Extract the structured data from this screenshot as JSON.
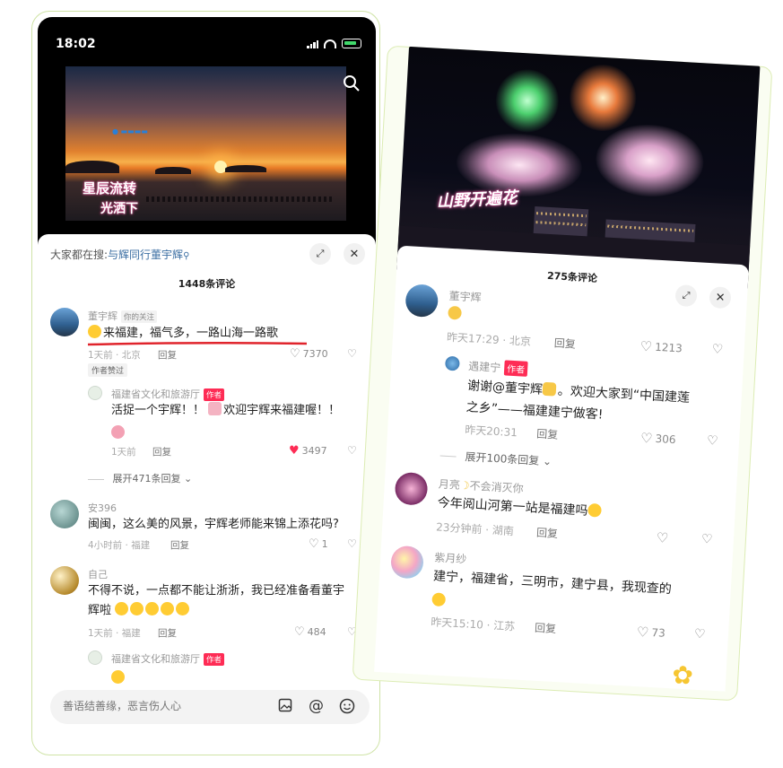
{
  "left": {
    "status_time": "18:02",
    "video_overlay_line1": "星辰流转",
    "video_overlay_line2": "光洒下",
    "trending_prefix": "大家都在搜:",
    "trending_query": "与辉同行董宇辉",
    "comment_count": "1448条评论",
    "comments": [
      {
        "name": "董宇辉",
        "badge": "你的关注",
        "text": "来福建，福气多，一路山海一路歌",
        "meta": "1天前 · 北京",
        "reply": "回复",
        "likes": "7370",
        "author_liked": "作者赞过",
        "sub": {
          "name": "福建省文化和旅游厅",
          "tag": "作者",
          "text1": "活捉一个宇辉！！",
          "text2": "欢迎宇辉来福建喔！！",
          "meta": "1天前",
          "reply": "回复",
          "likes": "3497"
        },
        "expand": "展开471条回复"
      },
      {
        "name": "安396",
        "text": "闽闽，这么美的风景，宇辉老师能来锦上添花吗?",
        "meta": "4小时前 · 福建",
        "reply": "回复",
        "likes": "1"
      },
      {
        "name": "自己",
        "text1": "不得不说，一点都不能让浙浙，我已经准备看董宇",
        "text2": "辉啦",
        "meta": "1天前 · 福建",
        "reply": "回复",
        "likes": "484",
        "sub": {
          "name": "福建省文化和旅游厅",
          "tag": "作者"
        }
      }
    ],
    "input_placeholder": "善语结善缘，恶言伤人心",
    "at_symbol": "@"
  },
  "right": {
    "video_overlay": "山野开遍花",
    "comment_count": "275条评论",
    "comments": [
      {
        "name": "董宇辉",
        "meta": "昨天17:29 · 北京",
        "reply": "回复",
        "likes": "1213",
        "sub": {
          "name": "遇建宁",
          "tag": "作者",
          "text1": "谢谢@董宇辉",
          "text1b": "。欢迎大家到“中国建莲",
          "text2": "之乡”——福建建宁做客!",
          "meta": "昨天20:31",
          "reply": "回复",
          "likes": "306"
        },
        "expand": "展开100条回复"
      },
      {
        "name": "月亮",
        "name2": "不会消灭你",
        "text": "今年阅山河第一站是福建吗",
        "meta": "23分钟前 · 湖南",
        "reply": "回复"
      },
      {
        "name": "紫月纱",
        "text": "建宁，福建省，三明市，建宁县，我现查的",
        "meta": "昨天15:10 · 江苏",
        "reply": "回复",
        "likes": "73"
      }
    ]
  },
  "colors": {
    "accent_red": "#fe2c55",
    "underline_red": "#e0242c",
    "frame_green": "#cfe3a6",
    "link_blue": "#3c6fa3"
  }
}
